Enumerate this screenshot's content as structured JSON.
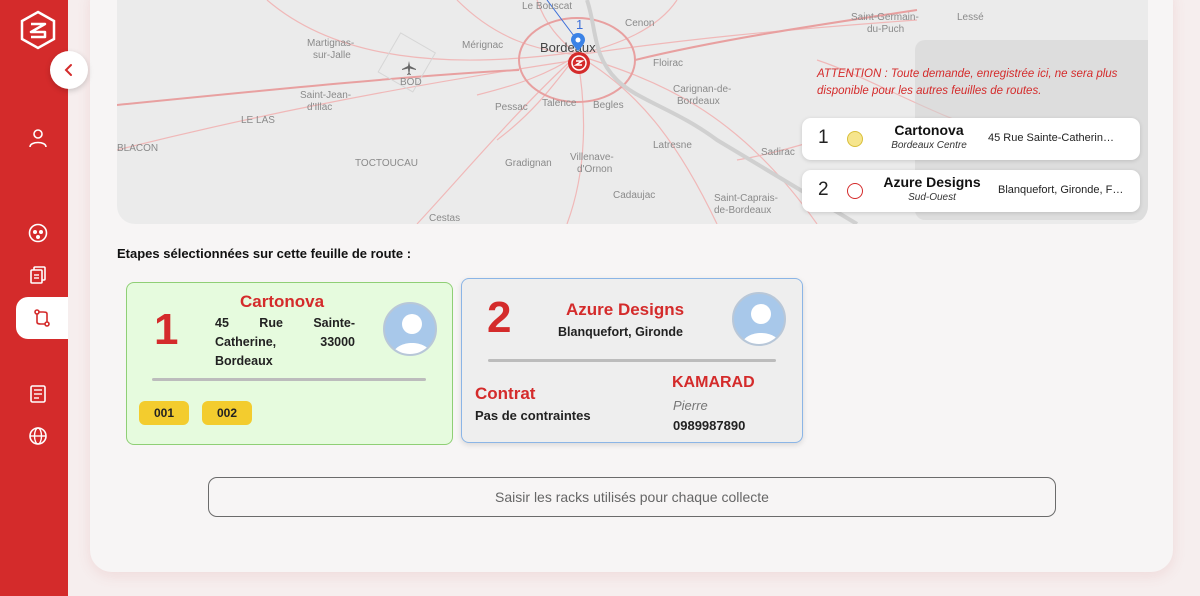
{
  "map": {
    "marker_number": "1",
    "labels": {
      "le_bouscat": "Le Bouscat",
      "cenon": "Cenon",
      "saint_germain": "Saint-Germain-",
      "du_puch": "du-Puch",
      "lesse": "Lessé",
      "martignas": "Martignas-",
      "sur_jalle": "sur-Jalle",
      "merignac": "Mérignac",
      "bordeaux": "Bordeaux",
      "floirac": "Floirac",
      "bod": "BOD",
      "saint_jean": "Saint-Jean-",
      "d_illac": "d'Illac",
      "pessac": "Pessac",
      "talence": "Talence",
      "begles": "Begles",
      "carignan": "Carignan-de-",
      "bordeaux2": "Bordeaux",
      "le_las": "LE LAS",
      "latresne": "Latresne",
      "sadirac": "Sadirac",
      "blacon": "BLACON",
      "gradignan": "Gradignan",
      "villenave": "Villenave-",
      "dornon": "d'Ornon",
      "toctoucau": "TOCTOUCAU",
      "cadaujac": "Cadaujac",
      "saint_caprais": "Saint-Caprais-",
      "de_bordeaux": "de-Bordeaux",
      "cestas": "Cestas"
    }
  },
  "warning": "ATTENTION : Toute demande, enregistrée ici, ne sera plus disponible pour les autres feuilles de routes.",
  "route_stops": [
    {
      "num": "1",
      "name": "Cartonova",
      "sub": "Bordeaux Centre",
      "address": "45 Rue Sainte-Catherin…",
      "dot_color": "#f6e58d",
      "dot_border": "#d9bf3a"
    },
    {
      "num": "2",
      "name": "Azure Designs",
      "sub": "Sud-Ouest",
      "address": "Blanquefort, Gironde, F…",
      "dot_color": "#ffffff",
      "dot_border": "#d42b2b"
    }
  ],
  "steps_title": "Etapes sélectionnées sur cette feuille de route :",
  "step1": {
    "num": "1",
    "name": "Cartonova",
    "address_line1": "45 Rue Sainte-",
    "address_line2": "Catherine, 33000",
    "address_line3": "Bordeaux",
    "tags": [
      "001",
      "002"
    ]
  },
  "step2": {
    "num": "2",
    "name": "Azure Designs",
    "address": "Blanquefort, Gironde",
    "contract_label": "Contrat",
    "contract_value": "Pas de contraintes",
    "contact_company": "KAMARAD",
    "contact_name": "Pierre",
    "contact_phone": "0989987890"
  },
  "rack_button": "Saisir les racks utilisés pour chaque collecte",
  "colors": {
    "brand_red": "#d42b2b",
    "green_card": "#e6fbde",
    "tag_yellow": "#f3cc2e"
  },
  "icons": {
    "logo": "brand-logo-icon",
    "collapse": "chevron-left-icon",
    "user": "user-icon",
    "group": "group-icon",
    "documents": "documents-icon",
    "routes": "route-icon",
    "reports": "report-icon",
    "globe": "globe-icon"
  }
}
